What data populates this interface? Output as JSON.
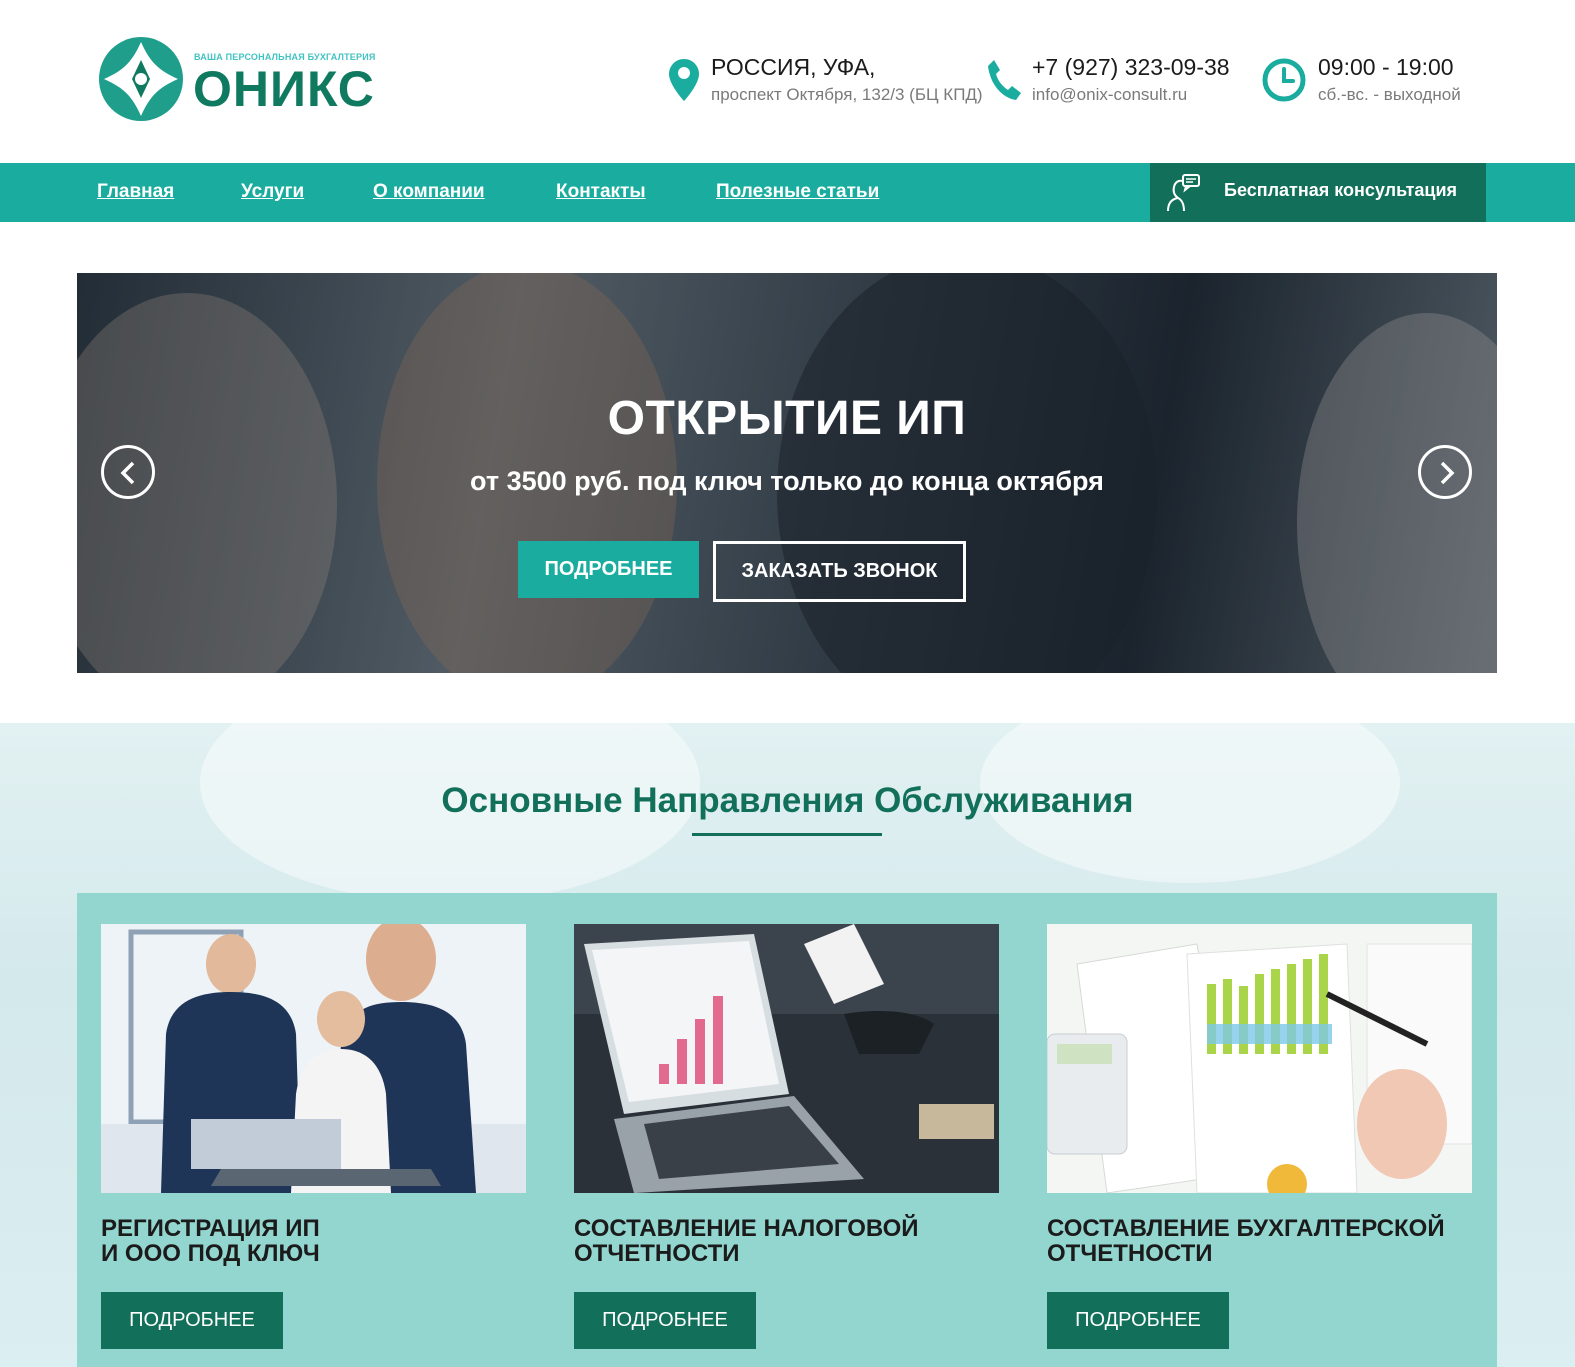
{
  "header": {
    "logo_tagline": "ВАША ПЕРСОНАЛЬНАЯ БУХГАЛТЕРИЯ",
    "logo_name": "ОНИКС",
    "address_city": "РОССИЯ, УФА,",
    "address_street": "проспект Октября, 132/3 (БЦ КПД)",
    "phone": "+7 (927) 323-09-38",
    "email": "info@onix-consult.ru",
    "hours": "09:00 - 19:00",
    "hours_note": "сб.-вс. - выходной"
  },
  "nav": {
    "items": [
      {
        "label": "Главная"
      },
      {
        "label": "Услуги"
      },
      {
        "label": "О компании"
      },
      {
        "label": "Контакты"
      },
      {
        "label": "Полезные статьи"
      }
    ],
    "consult_label": "Бесплатная консультация"
  },
  "hero": {
    "title": "ОТКРЫТИЕ ИП",
    "subtitle": "от 3500 руб. под ключ только до конца октября",
    "btn_more": "ПОДРОБНЕЕ",
    "btn_call": "ЗАКАЗАТЬ ЗВОНОК"
  },
  "services": {
    "title": "Основные Направления Обслуживания",
    "cards": [
      {
        "line1": "РЕГИСТРАЦИЯ ИП",
        "line2": "И ООО ПОД КЛЮЧ",
        "button": "ПОДРОБНЕЕ"
      },
      {
        "line1": "СОСТАВЛЕНИЕ НАЛОГОВОЙ",
        "line2": "ОТЧЕТНОСТИ",
        "button": "ПОДРОБНЕЕ"
      },
      {
        "line1": "СОСТАВЛЕНИЕ БУХГАЛТЕРСКОЙ",
        "line2": "ОТЧЕТНОСТИ",
        "button": "ПОДРОБНЕЕ"
      }
    ]
  },
  "colors": {
    "teal": "#1aad9f",
    "dark_green": "#12705a",
    "panel": "#93d6d0"
  },
  "icons": [
    "logo-mark-icon",
    "location-pin-icon",
    "phone-icon",
    "clock-icon",
    "consultant-icon",
    "chevron-left-icon",
    "chevron-right-icon"
  ]
}
